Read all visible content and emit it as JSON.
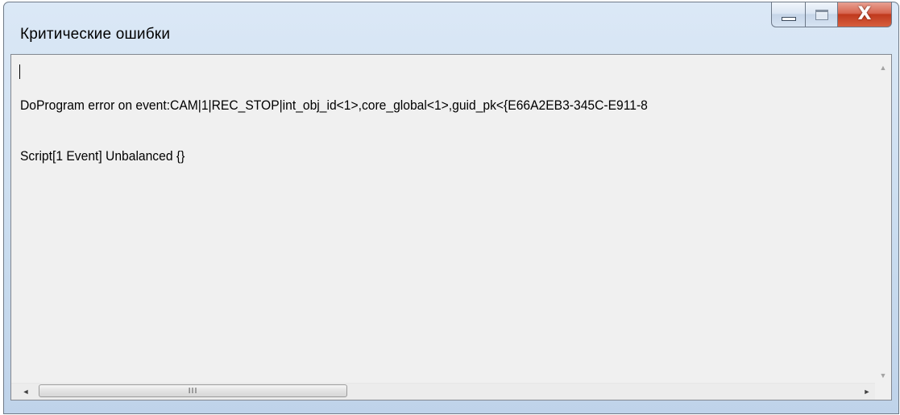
{
  "window": {
    "title": "Критические ошибки"
  },
  "caption_buttons": {
    "minimize_icon": "minimize-icon",
    "maximize_icon": "maximize-icon",
    "close_glyph": "X"
  },
  "error_text": {
    "lines": [
      "DoProgram error on event:CAM|1|REC_STOP|int_obj_id<1>,core_global<1>,guid_pk<{E66A2EB3-345C-E911-8",
      "Script[1 Event] Unbalanced {}"
    ]
  },
  "scrollbar": {
    "up_arrow": "▲",
    "down_arrow": "▼",
    "left_arrow": "◄",
    "right_arrow": "►",
    "grip": "III"
  },
  "colors": {
    "close_button": "#c0391d",
    "titlebar": "#c9dcef",
    "client_background": "#f0f0f0"
  }
}
